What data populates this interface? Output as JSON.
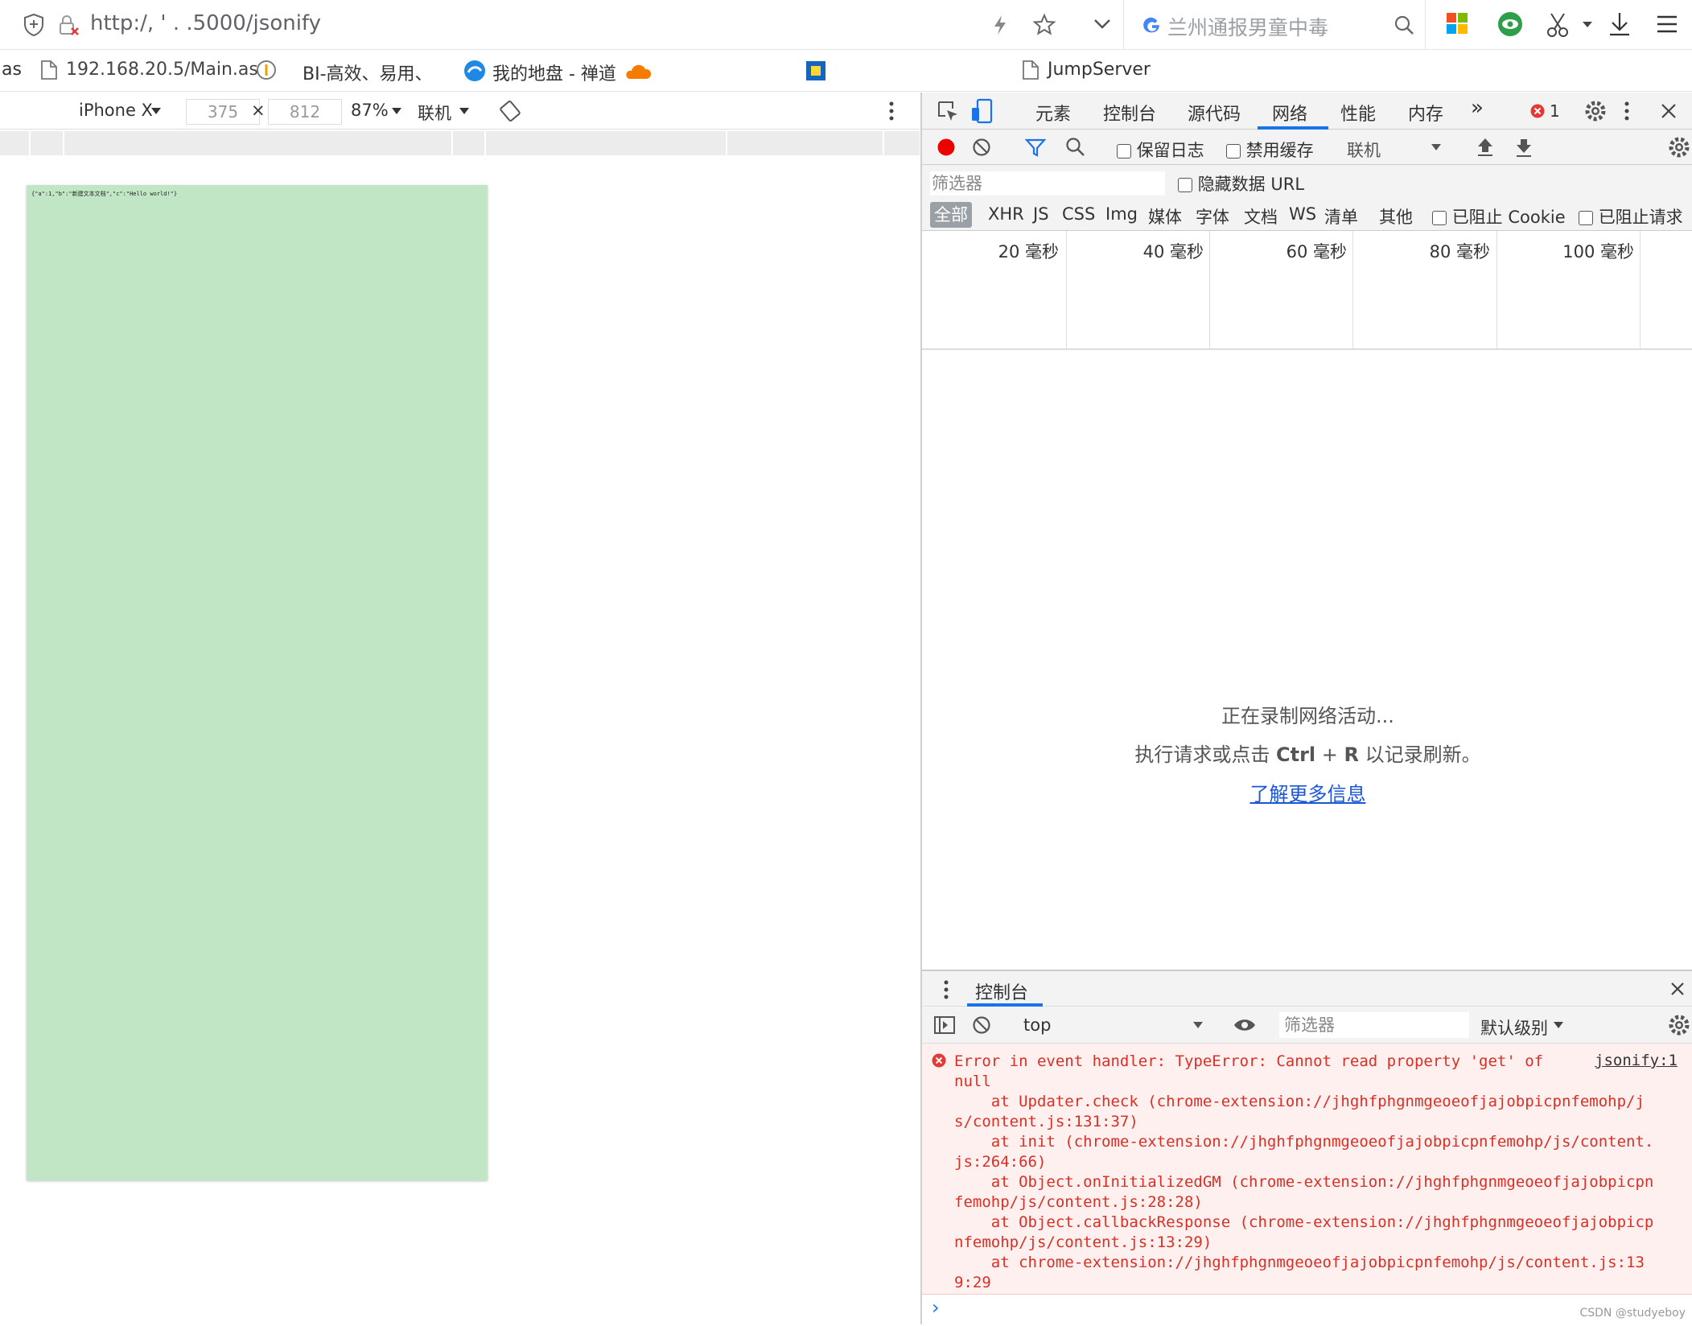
{
  "browser": {
    "url": "http:/,  '   .     .5000/jsonify",
    "search_placeholder": "兰州通报男童中毒",
    "bookmarks": [
      "as",
      "192.168.20.5/Main.as",
      "BI-高效、易用、",
      "我的地盘 - 禅道",
      "JumpServer"
    ]
  },
  "device_toolbar": {
    "device": "iPhone X",
    "width": "375",
    "times": "×",
    "height": "812",
    "zoom": "87%",
    "throttle": "联机"
  },
  "page": {
    "json_text": "{\"a\":1,\"b\":\"新建文本文档\",\"c\":\"Hello world!\"}"
  },
  "devtools": {
    "tabs": [
      "元素",
      "控制台",
      "源代码",
      "网络",
      "性能",
      "内存"
    ],
    "more": "»",
    "error_count": "1",
    "network": {
      "preserve_log": "保留日志",
      "disable_cache": "禁用缓存",
      "throttle": "联机",
      "filter_placeholder": "筛选器",
      "hide_data_url": "隐藏数据 URL",
      "types": [
        "全部",
        "XHR",
        "JS",
        "CSS",
        "Img",
        "媒体",
        "字体",
        "文档",
        "WS",
        "清单",
        "其他"
      ],
      "blocked_cookies": "已阻止 Cookie",
      "blocked_requests": "已阻止请求",
      "timeline": [
        "20 毫秒",
        "40 毫秒",
        "60 毫秒",
        "80 毫秒",
        "100 毫秒"
      ],
      "recording": "正在录制网络活动...",
      "hint_prefix": "执行请求或点击 ",
      "hint_key1": "Ctrl",
      "hint_plus": " + ",
      "hint_key2": "R",
      "hint_suffix": " 以记录刷新。",
      "learn_more": "了解更多信息"
    },
    "console": {
      "title": "控制台",
      "context": "top",
      "filter_placeholder": "筛选器",
      "level": "默认级别",
      "error_source": "jsonify:1",
      "error_text": "Error in event handler: TypeError: Cannot read property 'get' of\nnull\n    at Updater.check (chrome-extension://jhghfphgnmgeoeofjajobpicpnfemohp/j\ns/content.js:131:37)\n    at init (chrome-extension://jhghfphgnmgeoeofjajobpicpnfemohp/js/content.\njs:264:66)\n    at Object.onInitializedGM (chrome-extension://jhghfphgnmgeoeofjajobpicpn\nfemohp/js/content.js:28:28)\n    at Object.callbackResponse (chrome-extension://jhghfphgnmgeoeofjajobpicp\nnfemohp/js/content.js:13:29)\n    at chrome-extension://jhghfphgnmgeoeofjajobpicpnfemohp/js/content.js:13\n9:29",
      "prompt": "›"
    }
  },
  "watermark": "CSDN @studyeboy"
}
